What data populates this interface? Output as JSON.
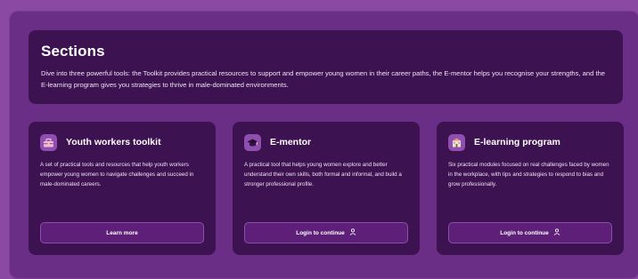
{
  "sections": {
    "title": "Sections",
    "description": "Dive into three powerful tools: the Toolkit provides practical resources to support and empower young women in their career paths, the E-mentor helps you recognise your strengths, and the E-learning program gives you strategies to thrive in male-dominated environments."
  },
  "cards": [
    {
      "title": "Youth workers toolkit",
      "description": "A set of practical tools and resources that help youth workers empower young women to navigate challenges and succeed in male-dominated careers.",
      "button": "Learn more",
      "icon": "toolkit-icon"
    },
    {
      "title": "E-mentor",
      "description": "A practical tool that helps young women explore and better understand their own skills, both formal and informal, and build a stronger professional profile.",
      "button": "Login to continue",
      "icon": "graduation-cap-icon"
    },
    {
      "title": "E-learning program",
      "description": "Six practical modules focused on real challenges faced by women in the workplace, with tips and strategies to respond to bias and grow professionally.",
      "button": "Login to continue",
      "icon": "school-building-icon"
    }
  ],
  "colors": {
    "page_background": "#8a4aa3",
    "panel": "#6b2e86",
    "card": "#3d1250",
    "button": "#5e1f78",
    "icon_tile": "#8f4fb0"
  }
}
